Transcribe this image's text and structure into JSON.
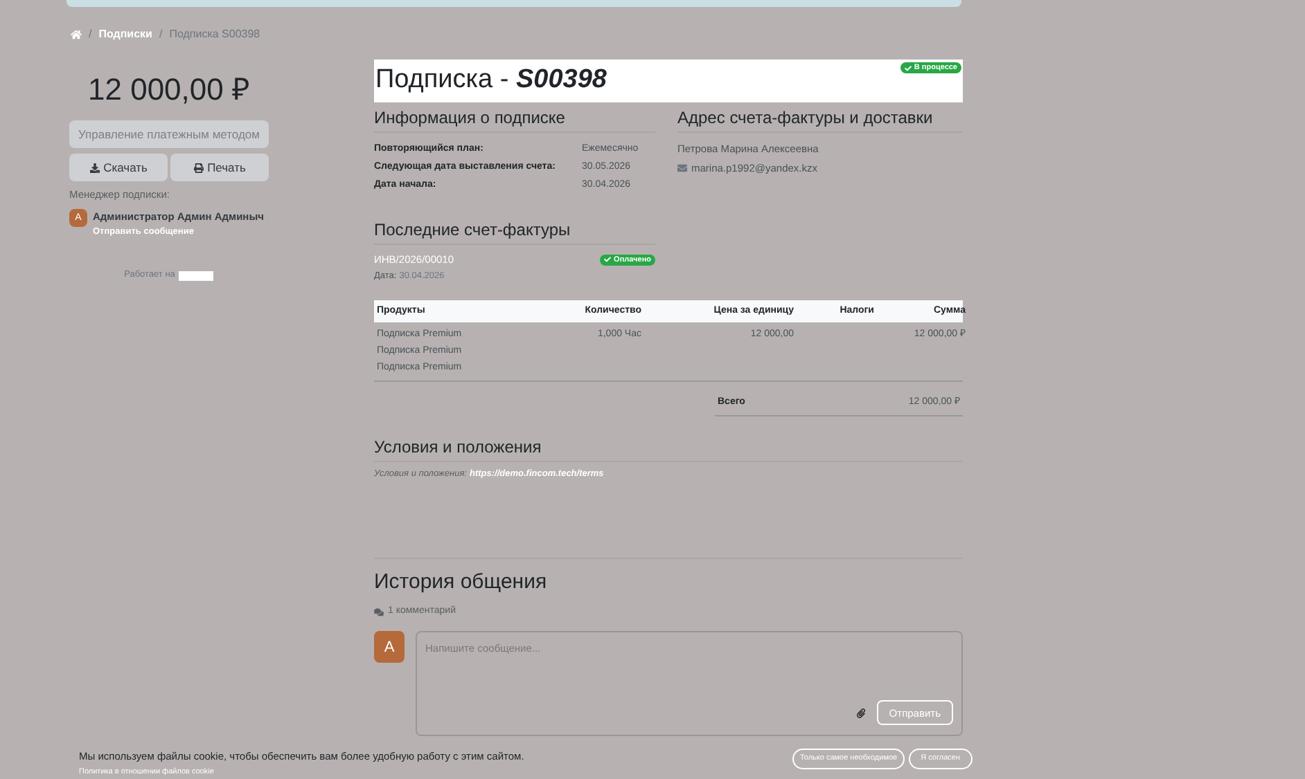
{
  "breadcrumb": [
    {
      "label": "Подписки"
    },
    {
      "label": "Подписка S00398"
    }
  ],
  "breadcrumb_separator": "/",
  "sidebar": {
    "amount": "12 000,00 ₽",
    "manage_button": "Управление платежным методом",
    "download_button": "Скачать",
    "print_button": "Печать",
    "manager_label": "Менеджер подписки:",
    "manager_initial": "A",
    "manager_name": "Администратор Админ Админыч",
    "send_message_link": "Отправить сообщение",
    "powered_by": "Работает на"
  },
  "header": {
    "title": "Подписка - ",
    "number": "S00398",
    "status": "В процессе"
  },
  "info": {
    "heading": "Информация о подписке",
    "rows": [
      {
        "label": "Повторяющийся план:",
        "value": "Ежемесячно"
      },
      {
        "label": "Следующая дата выставления счета:",
        "value": "30.05.2026"
      },
      {
        "label": "Дата начала:",
        "value": "30.04.2026"
      }
    ]
  },
  "address": {
    "heading": "Адрес счета-фактуры и доставки",
    "name": "Петрова Марина Алексеевна",
    "email": "marina.p1992@yandex.kzx"
  },
  "invoices": {
    "heading": "Последние счет-фактуры",
    "items": [
      {
        "number": "ИНВ/2026/00010",
        "status": "Оплачено",
        "date_label": "Дата:",
        "date": "30.04.2026"
      }
    ]
  },
  "table": {
    "columns": [
      "Продукты",
      "Количество",
      "Цена за единицу",
      "Налоги",
      "Сумма"
    ],
    "rows": [
      {
        "product": "Подписка Premium",
        "quantity": "1,000 Час",
        "price": "12 000,00",
        "sum": "12 000,00 ₽"
      },
      {
        "product": "Подписка Premium"
      },
      {
        "product": "Подписка Premium"
      }
    ],
    "total_label": "Всего",
    "total": "12 000,00 ₽"
  },
  "terms": {
    "heading": "Условия и положения",
    "label": "Условия и положения:",
    "link": "https://demo.fincom.tech/terms"
  },
  "history": {
    "heading": "История общения",
    "count": "1 комментарий",
    "avatar_initial": "A",
    "placeholder": "Напишите сообщение...",
    "send_button": "Отправить"
  },
  "cookie": {
    "text": "Мы используем файлы cookie, чтобы обеспечить вам более удобную работу с этим сайтом.",
    "policy_link": "Политика в отношении файлов cookie",
    "necessary_button": "Только самое необходимое",
    "agree_button": "Я согласен"
  }
}
